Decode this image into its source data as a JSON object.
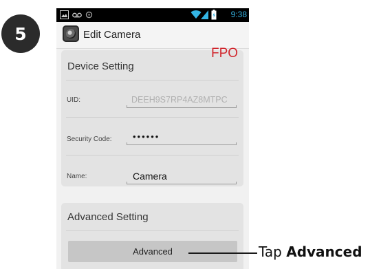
{
  "step": {
    "number": "5"
  },
  "status_bar": {
    "time": "9:38",
    "icons": [
      "gallery-icon",
      "voicemail-icon",
      "circle-icon",
      "wifi-icon",
      "signal-icon",
      "battery-icon"
    ]
  },
  "action_bar": {
    "icon": "camera-app-icon",
    "title": "Edit Camera"
  },
  "overlay": {
    "fpo": "FPO"
  },
  "device_setting": {
    "title": "Device Setting",
    "uid_label": "UID:",
    "uid_value": "DEEH9S7RP4AZ8MTPC",
    "security_label": "Security Code:",
    "security_value": "••••••",
    "name_label": "Name:",
    "name_value": "Camera"
  },
  "advanced_setting": {
    "title": "Advanced Setting",
    "button_label": "Advanced"
  },
  "callout": {
    "prefix": "Tap ",
    "emphasis": "Advanced"
  },
  "colors": {
    "status_time": "#34b5e5",
    "fpo": "#d1252c",
    "card_bg": "#e3e3e3",
    "button_bg": "#c6c6c6"
  }
}
